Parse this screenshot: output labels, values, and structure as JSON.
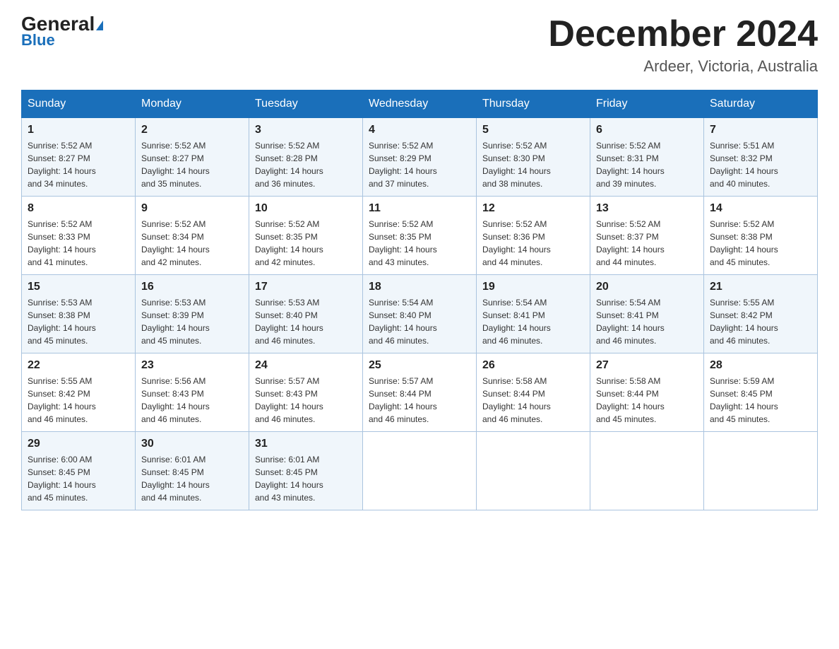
{
  "header": {
    "logo_general": "General",
    "logo_blue": "Blue",
    "month_title": "December 2024",
    "location": "Ardeer, Victoria, Australia"
  },
  "days_of_week": [
    "Sunday",
    "Monday",
    "Tuesday",
    "Wednesday",
    "Thursday",
    "Friday",
    "Saturday"
  ],
  "weeks": [
    [
      {
        "day": "1",
        "sunrise": "5:52 AM",
        "sunset": "8:27 PM",
        "daylight": "14 hours and 34 minutes."
      },
      {
        "day": "2",
        "sunrise": "5:52 AM",
        "sunset": "8:27 PM",
        "daylight": "14 hours and 35 minutes."
      },
      {
        "day": "3",
        "sunrise": "5:52 AM",
        "sunset": "8:28 PM",
        "daylight": "14 hours and 36 minutes."
      },
      {
        "day": "4",
        "sunrise": "5:52 AM",
        "sunset": "8:29 PM",
        "daylight": "14 hours and 37 minutes."
      },
      {
        "day": "5",
        "sunrise": "5:52 AM",
        "sunset": "8:30 PM",
        "daylight": "14 hours and 38 minutes."
      },
      {
        "day": "6",
        "sunrise": "5:52 AM",
        "sunset": "8:31 PM",
        "daylight": "14 hours and 39 minutes."
      },
      {
        "day": "7",
        "sunrise": "5:51 AM",
        "sunset": "8:32 PM",
        "daylight": "14 hours and 40 minutes."
      }
    ],
    [
      {
        "day": "8",
        "sunrise": "5:52 AM",
        "sunset": "8:33 PM",
        "daylight": "14 hours and 41 minutes."
      },
      {
        "day": "9",
        "sunrise": "5:52 AM",
        "sunset": "8:34 PM",
        "daylight": "14 hours and 42 minutes."
      },
      {
        "day": "10",
        "sunrise": "5:52 AM",
        "sunset": "8:35 PM",
        "daylight": "14 hours and 42 minutes."
      },
      {
        "day": "11",
        "sunrise": "5:52 AM",
        "sunset": "8:35 PM",
        "daylight": "14 hours and 43 minutes."
      },
      {
        "day": "12",
        "sunrise": "5:52 AM",
        "sunset": "8:36 PM",
        "daylight": "14 hours and 44 minutes."
      },
      {
        "day": "13",
        "sunrise": "5:52 AM",
        "sunset": "8:37 PM",
        "daylight": "14 hours and 44 minutes."
      },
      {
        "day": "14",
        "sunrise": "5:52 AM",
        "sunset": "8:38 PM",
        "daylight": "14 hours and 45 minutes."
      }
    ],
    [
      {
        "day": "15",
        "sunrise": "5:53 AM",
        "sunset": "8:38 PM",
        "daylight": "14 hours and 45 minutes."
      },
      {
        "day": "16",
        "sunrise": "5:53 AM",
        "sunset": "8:39 PM",
        "daylight": "14 hours and 45 minutes."
      },
      {
        "day": "17",
        "sunrise": "5:53 AM",
        "sunset": "8:40 PM",
        "daylight": "14 hours and 46 minutes."
      },
      {
        "day": "18",
        "sunrise": "5:54 AM",
        "sunset": "8:40 PM",
        "daylight": "14 hours and 46 minutes."
      },
      {
        "day": "19",
        "sunrise": "5:54 AM",
        "sunset": "8:41 PM",
        "daylight": "14 hours and 46 minutes."
      },
      {
        "day": "20",
        "sunrise": "5:54 AM",
        "sunset": "8:41 PM",
        "daylight": "14 hours and 46 minutes."
      },
      {
        "day": "21",
        "sunrise": "5:55 AM",
        "sunset": "8:42 PM",
        "daylight": "14 hours and 46 minutes."
      }
    ],
    [
      {
        "day": "22",
        "sunrise": "5:55 AM",
        "sunset": "8:42 PM",
        "daylight": "14 hours and 46 minutes."
      },
      {
        "day": "23",
        "sunrise": "5:56 AM",
        "sunset": "8:43 PM",
        "daylight": "14 hours and 46 minutes."
      },
      {
        "day": "24",
        "sunrise": "5:57 AM",
        "sunset": "8:43 PM",
        "daylight": "14 hours and 46 minutes."
      },
      {
        "day": "25",
        "sunrise": "5:57 AM",
        "sunset": "8:44 PM",
        "daylight": "14 hours and 46 minutes."
      },
      {
        "day": "26",
        "sunrise": "5:58 AM",
        "sunset": "8:44 PM",
        "daylight": "14 hours and 46 minutes."
      },
      {
        "day": "27",
        "sunrise": "5:58 AM",
        "sunset": "8:44 PM",
        "daylight": "14 hours and 45 minutes."
      },
      {
        "day": "28",
        "sunrise": "5:59 AM",
        "sunset": "8:45 PM",
        "daylight": "14 hours and 45 minutes."
      }
    ],
    [
      {
        "day": "29",
        "sunrise": "6:00 AM",
        "sunset": "8:45 PM",
        "daylight": "14 hours and 45 minutes."
      },
      {
        "day": "30",
        "sunrise": "6:01 AM",
        "sunset": "8:45 PM",
        "daylight": "14 hours and 44 minutes."
      },
      {
        "day": "31",
        "sunrise": "6:01 AM",
        "sunset": "8:45 PM",
        "daylight": "14 hours and 43 minutes."
      },
      null,
      null,
      null,
      null
    ]
  ],
  "labels": {
    "sunrise": "Sunrise:",
    "sunset": "Sunset:",
    "daylight": "Daylight:"
  }
}
